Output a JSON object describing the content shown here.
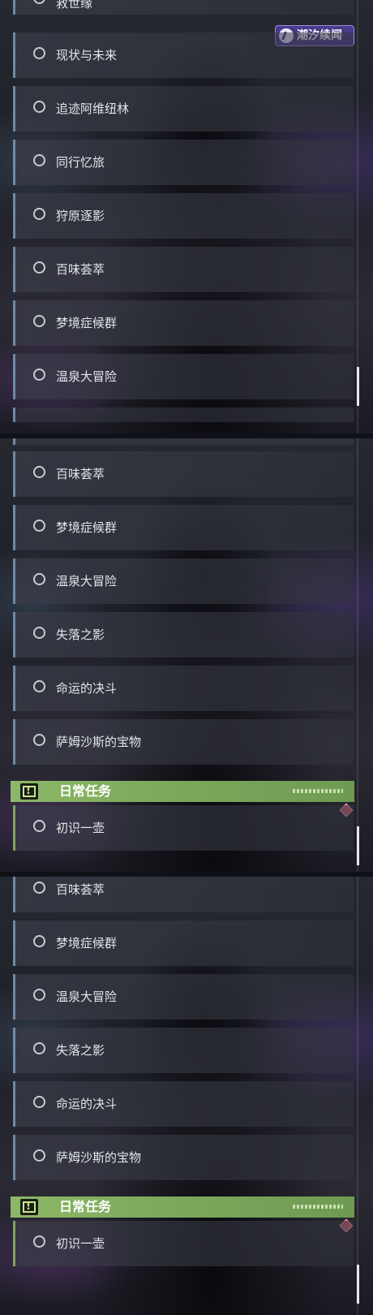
{
  "brand": {
    "logo_text": "潮汐续闻"
  },
  "panels": [
    {
      "top_partial_label": "救世缘",
      "items": [
        {
          "label": "现状与未来"
        },
        {
          "label": "追迹阿维纽林"
        },
        {
          "label": "同行忆旅"
        },
        {
          "label": "狩原逐影"
        },
        {
          "label": "百味荟萃"
        },
        {
          "label": "梦境症候群"
        },
        {
          "label": "温泉大冒险"
        }
      ]
    },
    {
      "items": [
        {
          "label": "百味荟萃"
        },
        {
          "label": "梦境症候群"
        },
        {
          "label": "温泉大冒险"
        },
        {
          "label": "失落之影"
        },
        {
          "label": "命运的决斗"
        },
        {
          "label": "萨姆沙斯的宝物"
        }
      ],
      "daily_header": {
        "title": "日常任务"
      },
      "daily_items": [
        {
          "label": "初识一壶"
        }
      ]
    },
    {
      "items": [
        {
          "label": "百味荟萃"
        },
        {
          "label": "梦境症候群"
        },
        {
          "label": "温泉大冒险"
        },
        {
          "label": "失落之影"
        },
        {
          "label": "命运的决斗"
        },
        {
          "label": "萨姆沙斯的宝物"
        }
      ],
      "daily_header": {
        "title": "日常任务"
      },
      "daily_items": [
        {
          "label": "初识一壶"
        }
      ]
    }
  ],
  "colors": {
    "item_accent": "#6e8aa8",
    "daily_accent": "#7fa35a",
    "daily_header_bg": "#8cb866",
    "badge": "#c85a6c",
    "logo_bg": "#4a3a8c"
  },
  "icons": {
    "item_status": "radio-circle-icon",
    "daily_header": "exclamation-box-icon",
    "new_badge": "red-diamond-icon",
    "brand": "feather-logo-icon"
  }
}
